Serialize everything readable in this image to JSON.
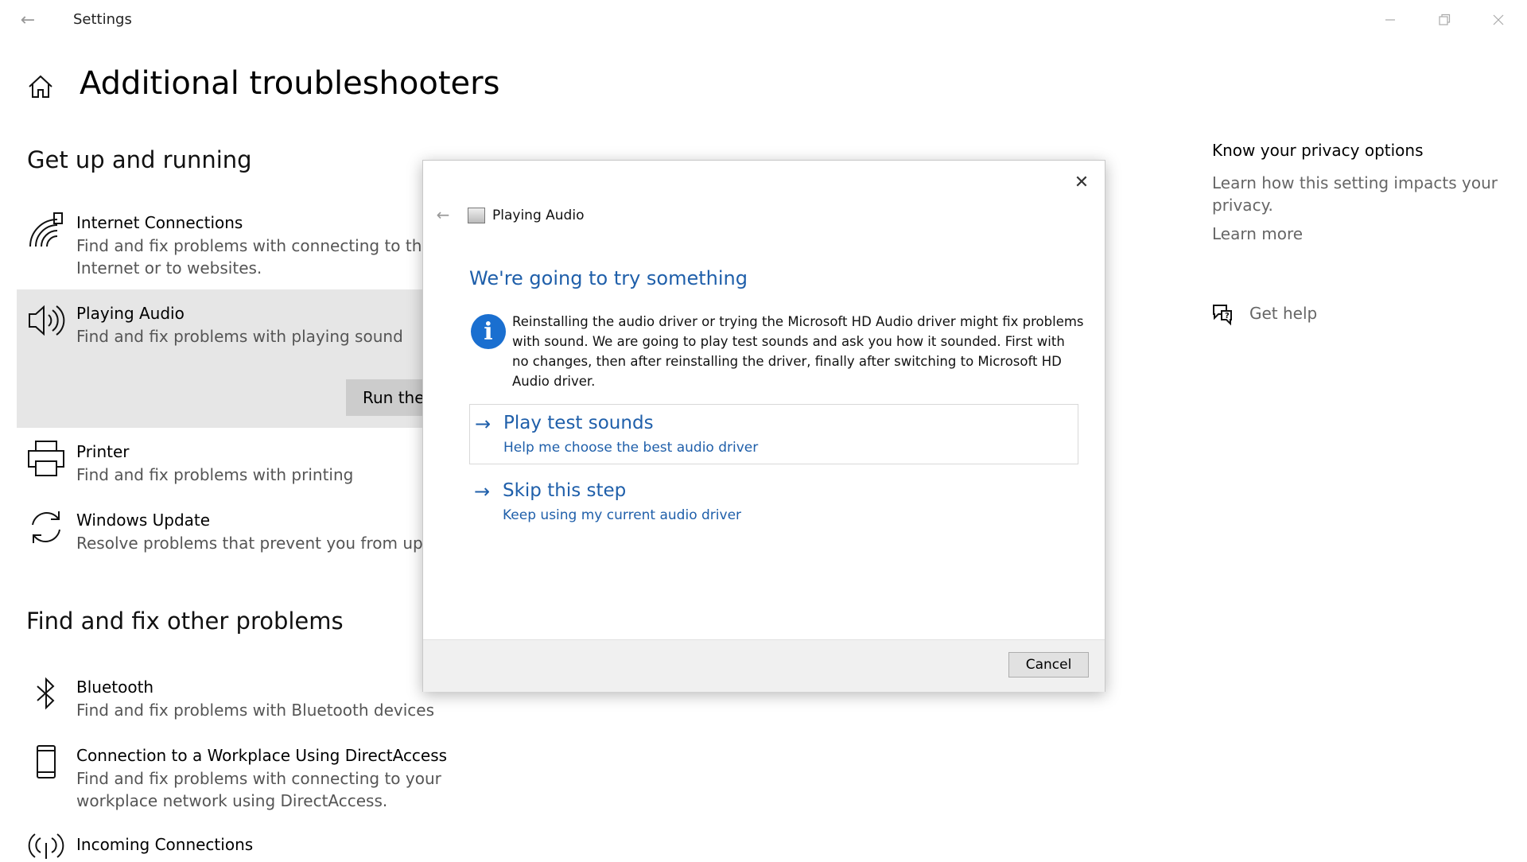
{
  "window": {
    "title": "Settings",
    "back_icon": "back-arrow-icon",
    "minimize_icon": "minimize-icon",
    "restore_icon": "restore-icon",
    "close_icon": "close-icon"
  },
  "page": {
    "title": "Additional troubleshooters",
    "home_icon": "home-icon"
  },
  "sections": {
    "get_up_running": {
      "title": "Get up and running",
      "items": [
        {
          "title": "Internet Connections",
          "desc": "Find and fix problems with connecting to the Internet or to websites.",
          "icon": "wifi-icon"
        },
        {
          "title": "Playing Audio",
          "desc": "Find and fix problems with playing sound",
          "icon": "speaker-icon",
          "selected": true,
          "run_label": "Run the troubleshooter"
        },
        {
          "title": "Printer",
          "desc": "Find and fix problems with printing",
          "icon": "printer-icon"
        },
        {
          "title": "Windows Update",
          "desc": "Resolve problems that prevent you from updating Windows.",
          "icon": "refresh-icon"
        }
      ]
    },
    "other_problems": {
      "title": "Find and fix other problems",
      "items": [
        {
          "title": "Bluetooth",
          "desc": "Find and fix problems with Bluetooth devices",
          "icon": "bluetooth-icon"
        },
        {
          "title": "Connection to a Workplace Using DirectAccess",
          "desc": "Find and fix problems with connecting to your workplace network using DirectAccess.",
          "icon": "phone-icon"
        },
        {
          "title": "Incoming Connections",
          "desc": "",
          "icon": "antenna-icon"
        }
      ]
    }
  },
  "sidebar": {
    "privacy_title": "Know your privacy options",
    "privacy_desc": "Learn how this setting impacts your privacy.",
    "learn_more": "Learn more",
    "get_help": "Get help",
    "get_help_icon": "help-chat-icon"
  },
  "dialog": {
    "app_title": "Playing Audio",
    "heading": "We're going to try something",
    "info_text": "Reinstalling the audio driver or trying the Microsoft HD Audio driver might fix problems with sound. We are going to play test sounds and ask you how it sounded. First with no changes, then after reinstalling the driver, finally after switching to Microsoft HD Audio driver.",
    "info_glyph": "i",
    "choices": [
      {
        "title": "Play test sounds",
        "sub": "Help me choose the best audio driver"
      },
      {
        "title": "Skip this step",
        "sub": "Keep using my current audio driver"
      }
    ],
    "cancel_label": "Cancel",
    "arrow_glyph": "→",
    "close_glyph": "✕",
    "back_glyph": "←"
  },
  "colors": {
    "accent": "#1f5faa",
    "selected_bg": "#e6e6e6",
    "info_blue": "#1a6fd0"
  }
}
